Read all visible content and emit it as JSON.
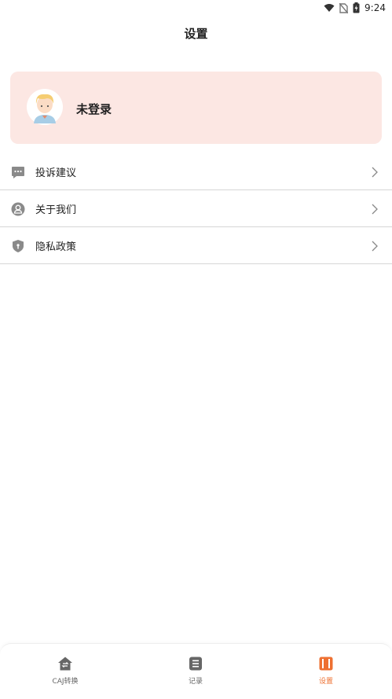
{
  "status_bar": {
    "time": "9:24"
  },
  "header": {
    "title": "设置"
  },
  "profile": {
    "name": "未登录"
  },
  "menu": [
    {
      "label": "投诉建议",
      "icon": "chat-icon"
    },
    {
      "label": "关于我们",
      "icon": "person-icon"
    },
    {
      "label": "隐私政策",
      "icon": "shield-icon"
    }
  ],
  "tabs": [
    {
      "label": "CAJ转换",
      "icon": "home-convert-icon",
      "active": false
    },
    {
      "label": "记录",
      "icon": "record-icon",
      "active": false
    },
    {
      "label": "设置",
      "icon": "settings-book-icon",
      "active": true
    }
  ],
  "colors": {
    "accent": "#ee7031",
    "card_bg": "#fce7e3",
    "icon_gray": "#8a8a8a"
  }
}
